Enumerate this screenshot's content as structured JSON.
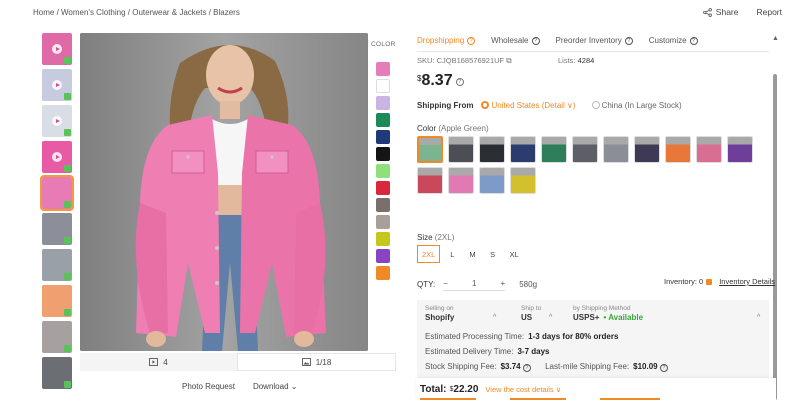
{
  "breadcrumb": [
    "Home",
    "Women's Clothing",
    "Outerwear & Jackets",
    "Blazers"
  ],
  "breadcrumb_sep": " / ",
  "top_actions": {
    "share": "Share",
    "report": "Report"
  },
  "thumbnails": [
    {
      "kind": "video",
      "color": "#e06aa8"
    },
    {
      "kind": "video",
      "color": "#c7cbe0"
    },
    {
      "kind": "video",
      "color": "#d9dde6"
    },
    {
      "kind": "video",
      "color": "#e85aa6"
    },
    {
      "kind": "image",
      "color": "#e77bb5",
      "selected": true
    },
    {
      "kind": "image",
      "color": "#8c8f9a"
    },
    {
      "kind": "image",
      "color": "#9aa0a8"
    },
    {
      "kind": "image",
      "color": "#f0a070"
    },
    {
      "kind": "image",
      "color": "#a89fa0"
    },
    {
      "kind": "image",
      "color": "#6b6f74"
    }
  ],
  "color_column": {
    "label": "COLOR",
    "swatches": [
      "#e57eb8",
      "#ffffff",
      "#cbb3e6",
      "#1e8a5a",
      "#1f3a78",
      "#151515",
      "#8fe07a",
      "#d9283c",
      "#7a6f6a",
      "#a89f98",
      "#c7c61c",
      "#8a44c2",
      "#f08a24"
    ]
  },
  "photo_footer": {
    "videos": "4",
    "images": "1/18"
  },
  "photo_links": {
    "request": "Photo Request",
    "download": "Download"
  },
  "tabs": [
    {
      "label": "Dropshipping",
      "active": true
    },
    {
      "label": "Wholesale",
      "active": false
    },
    {
      "label": "Preorder Inventory",
      "active": false
    },
    {
      "label": "Customize",
      "active": false
    }
  ],
  "sku": "SKU: CJQB168576921UF",
  "lists_label": "Lists:",
  "lists_value": "4284",
  "price": {
    "currency": "$",
    "amount": "8.37"
  },
  "shipping_from": {
    "label": "Shipping From",
    "selected": "United States",
    "detail": "(Detail ∨)",
    "other": "China (In Large Stock)"
  },
  "color_title": "Color",
  "color_selected": "(Apple Green)",
  "variants": [
    "#7bb48f",
    "#4c4e55",
    "#2c2e36",
    "#2b3d6e",
    "#2e7e5a",
    "#5e5f66",
    "#8b8e96",
    "#3e3a55",
    "#e8783a",
    "#d86f93",
    "#6e3e9a",
    "#c9485b",
    "#e17ab3",
    "#7d9ac8",
    "#d4c02f"
  ],
  "variant_selected_index": 0,
  "size_title": "Size",
  "size_selected": "(2XL)",
  "sizes": [
    "2XL",
    "L",
    "M",
    "S",
    "XL"
  ],
  "qty": {
    "label": "QTY:",
    "minus": "−",
    "value": "1",
    "plus": "+",
    "weight": "580g"
  },
  "inventory": {
    "label": "Inventory: 0",
    "link": "Inventory Details"
  },
  "logistics": {
    "selling_on_cap": "Selling on",
    "selling_on": "Shopify",
    "ship_to_cap": "Ship to",
    "ship_to": "US",
    "method_cap": "by Shipping Method",
    "method": "USPS+",
    "availability": "• Available"
  },
  "estimates": {
    "processing_label": "Estimated Processing Time:",
    "processing_value": "1-3 days for 80% orders",
    "delivery_label": "Estimated Delivery Time:",
    "delivery_value": "3-7 days",
    "stock_fee_label": "Stock Shipping Fee:",
    "stock_fee_value": "$3.74",
    "lastmile_label": "Last-mile Shipping Fee:",
    "lastmile_value": "$10.09"
  },
  "total": {
    "label": "Total:",
    "currency": "$",
    "amount": "22.20",
    "details": "View the cost details ∨"
  }
}
